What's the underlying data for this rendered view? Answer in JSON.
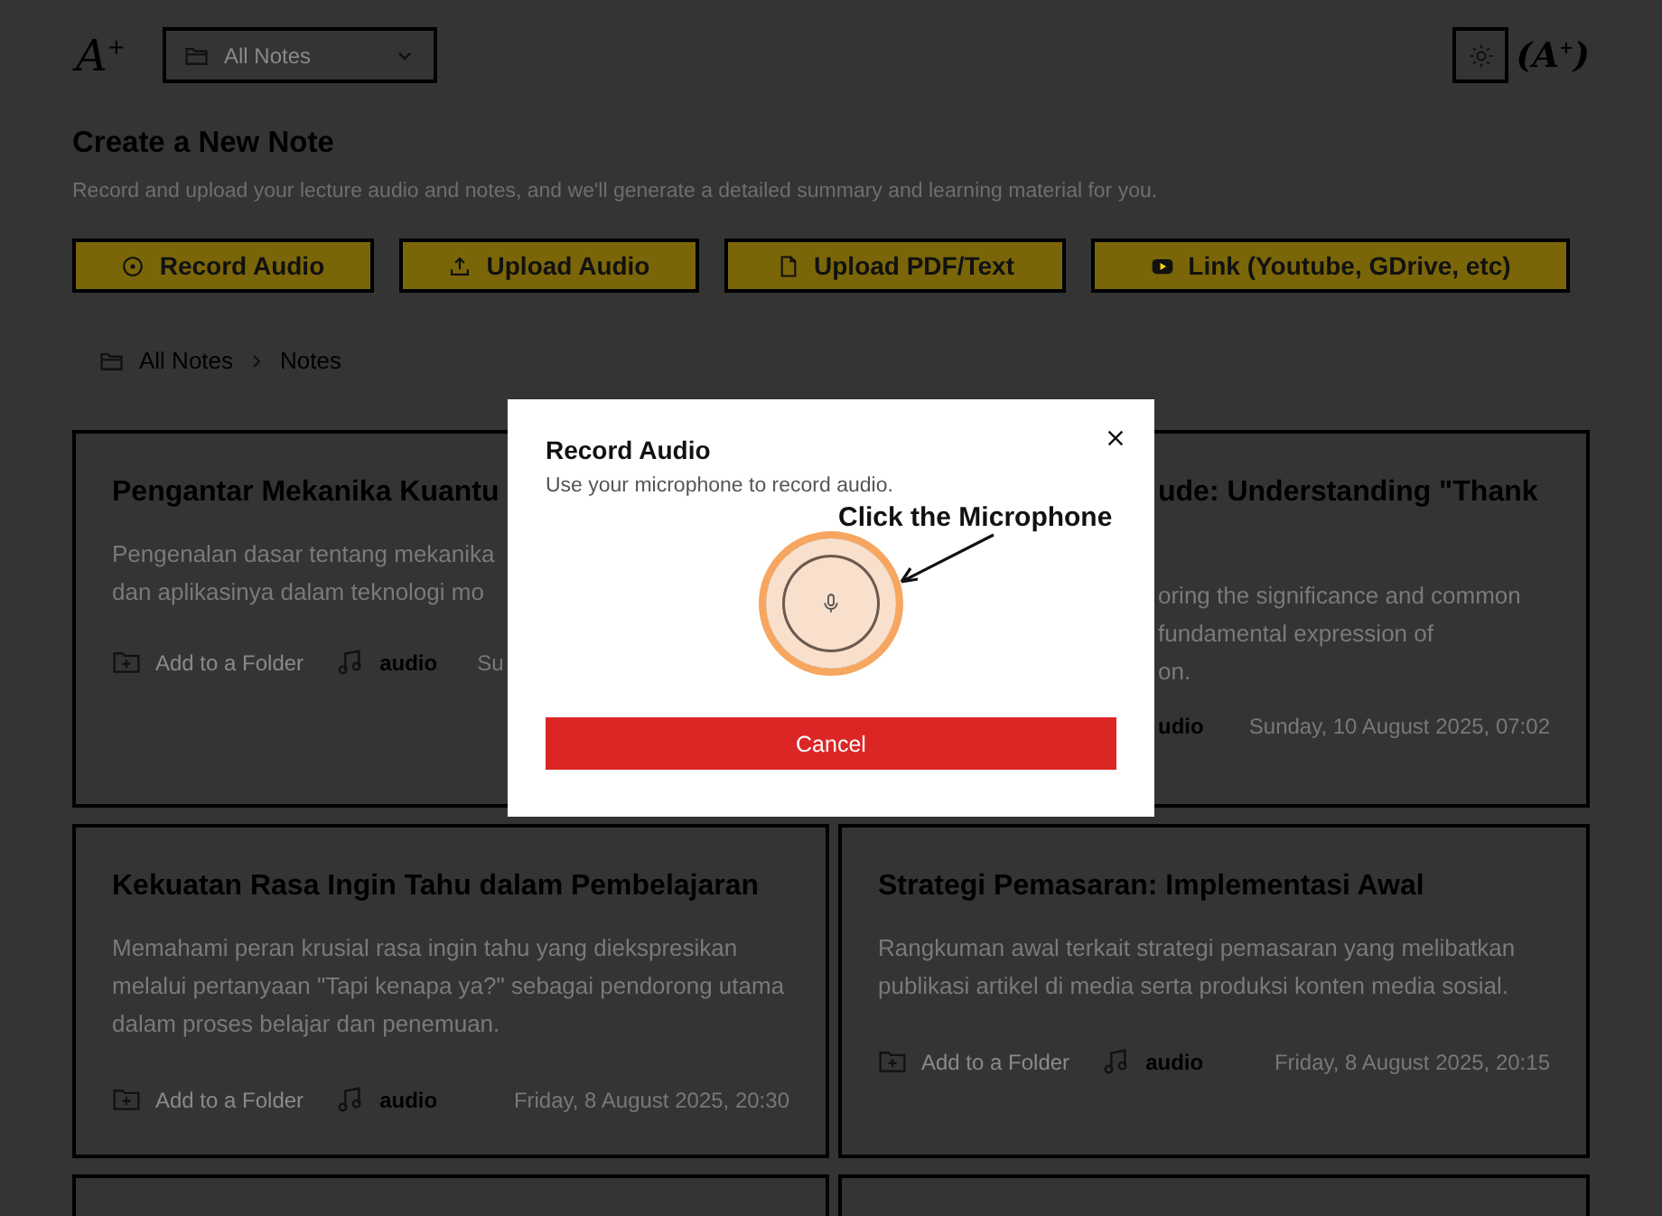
{
  "header": {
    "logo": "A$^{+}$",
    "folder_dropdown": "All Notes",
    "profile_logo": "(A$^{+}$)"
  },
  "page": {
    "title": "Create a New Note",
    "subtitle": "Record and upload your lecture audio and notes, and we'll generate a detailed summary and learning material for you."
  },
  "actions": [
    {
      "kind": "record",
      "label": "Record Audio"
    },
    {
      "kind": "upload",
      "label": "Upload Audio"
    },
    {
      "kind": "document",
      "label": "Upload PDF/Text"
    },
    {
      "kind": "video",
      "label": "Link (Youtube, GDrive, etc)"
    }
  ],
  "breadcrumb": [
    "All Notes",
    "Notes"
  ],
  "notes": [
    {
      "kind": "cut_right",
      "title": "Pengantar Mekanika Kuantu",
      "description_lines": [
        "Pengenalan dasar tentang mekanika",
        "dan aplikasinya dalam teknologi mo"
      ],
      "folder": "Add to a Folder",
      "type": "audio",
      "date": "Su"
    },
    {
      "kind": "cut_left",
      "title": "ude: Understanding \"Thank",
      "description_lines": [
        "oring the significance and common",
        "fundamental expression of",
        "on."
      ],
      "type": "udio",
      "date": "Sunday, 10 August 2025, 07:02"
    },
    {
      "kind": "full",
      "title": "Kekuatan Rasa Ingin Tahu dalam Pembelajaran",
      "description": "Memahami peran krusial rasa ingin tahu yang diekspresikan melalui pertanyaan \"Tapi kenapa ya?\" sebagai pendorong utama dalam proses belajar dan penemuan.",
      "folder": "Add to a Folder",
      "type": "audio",
      "date": "Friday, 8 August 2025, 20:30"
    },
    {
      "kind": "full",
      "title": "Strategi Pemasaran: Implementasi Awal",
      "description": "Rangkuman awal terkait strategi pemasaran yang melibatkan publikasi artikel di media serta produksi konten media sosial.",
      "folder": "Add to a Folder",
      "type": "audio",
      "date": "Friday, 8 August 2025, 20:15"
    },
    {
      "kind": "empty"
    },
    {
      "kind": "empty"
    }
  ],
  "modal": {
    "title": "Record Audio",
    "subtitle": "Use your microphone to record audio.",
    "cancel": "Cancel"
  },
  "annotation": "Click the Microphone"
}
